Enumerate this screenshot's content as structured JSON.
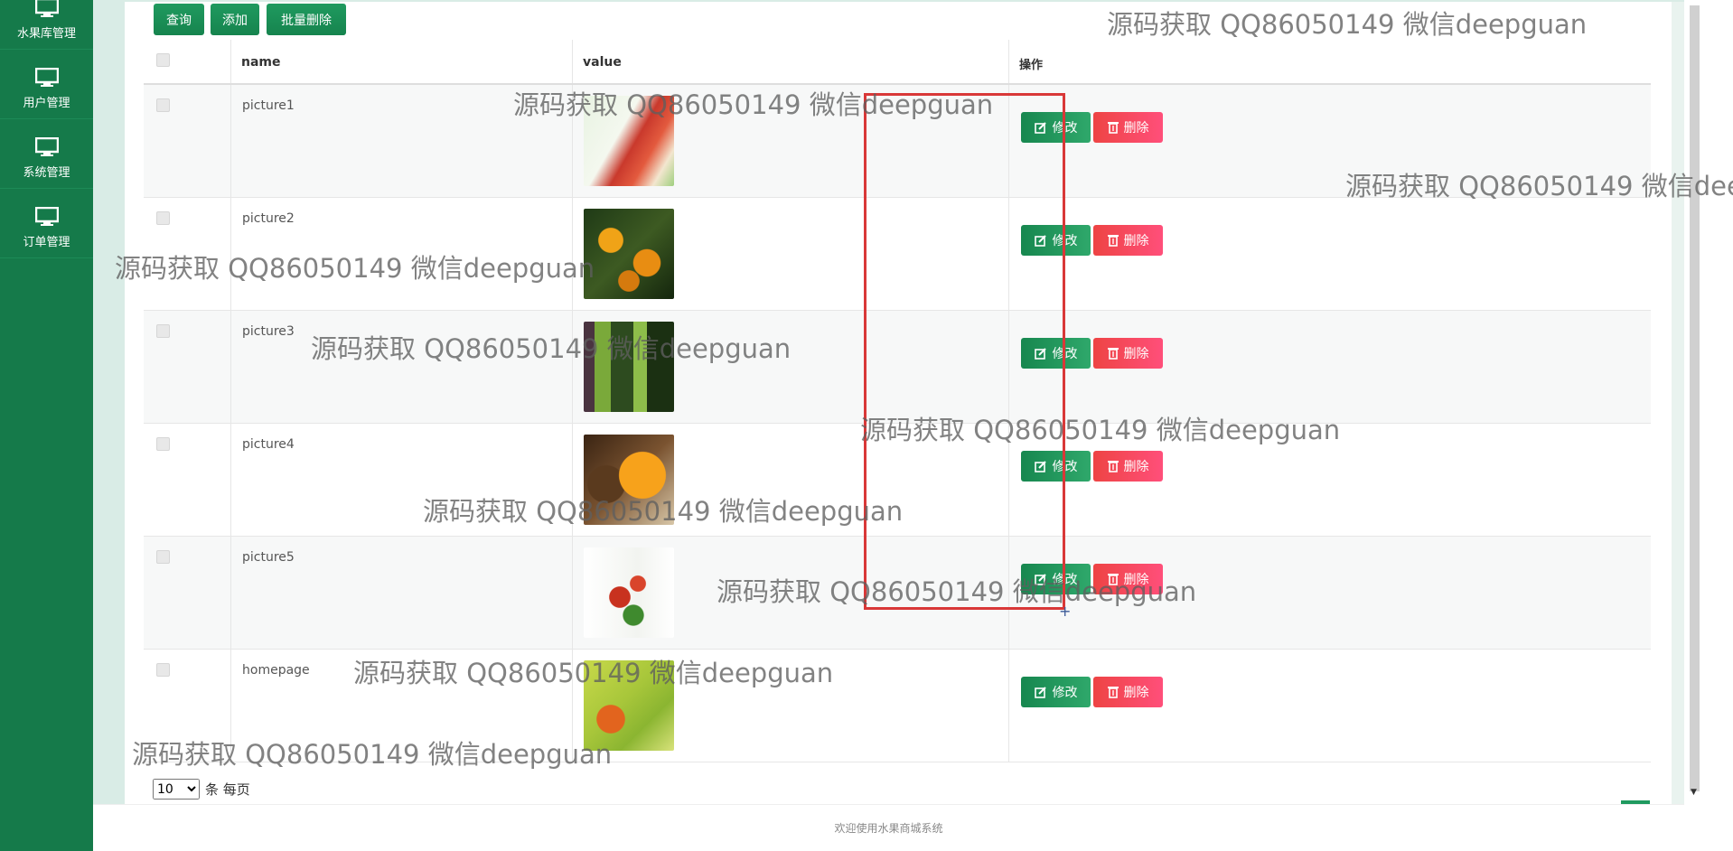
{
  "sidebar": {
    "items": [
      {
        "label": "水果库管理",
        "icon": "monitor-icon"
      },
      {
        "label": "用户管理",
        "icon": "monitor-icon"
      },
      {
        "label": "系统管理",
        "icon": "monitor-icon"
      },
      {
        "label": "订单管理",
        "icon": "monitor-icon"
      }
    ]
  },
  "toolbar": {
    "query_label": "查询",
    "add_label": "添加",
    "batch_delete_label": "批量删除"
  },
  "table": {
    "headers": {
      "name": "name",
      "value": "value",
      "actions": "操作"
    },
    "rows": [
      {
        "name": "picture1",
        "image": "apples-banner"
      },
      {
        "name": "picture2",
        "image": "oranges-tree"
      },
      {
        "name": "picture3",
        "image": "kiwi-slices"
      },
      {
        "name": "picture4",
        "image": "citrus-halves"
      },
      {
        "name": "picture5",
        "image": "red-berries"
      },
      {
        "name": "homepage",
        "image": "green-fruit-banner"
      }
    ],
    "edit_label": "修改",
    "delete_label": "删除"
  },
  "pagination": {
    "page_size": "10",
    "page_size_options": [
      "10"
    ],
    "suffix": "条 每页"
  },
  "footer": {
    "text": "欢迎使用水果商城系统"
  },
  "watermark": {
    "text": "源码获取 QQ86050149 微信deepguan"
  },
  "colors": {
    "sidebar": "#157a4a",
    "primary_button": "#1f9a5f",
    "danger_button": "#ee4444",
    "selection_rect": "#d93838"
  }
}
